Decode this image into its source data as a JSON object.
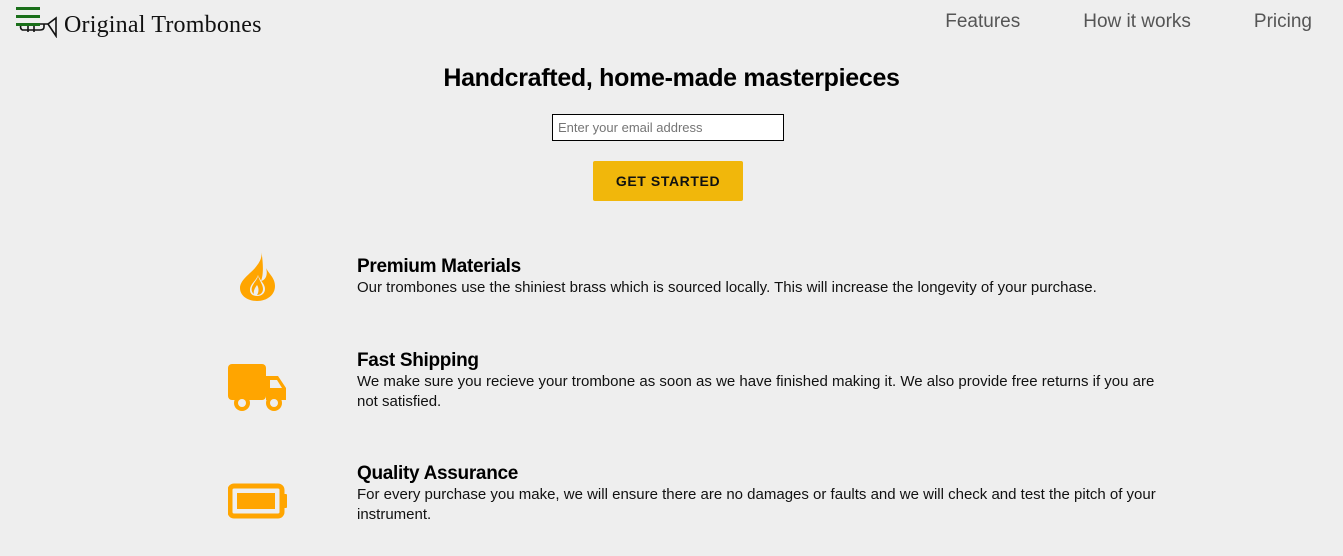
{
  "header": {
    "brand_title": "Original Trombones",
    "nav": [
      {
        "label": "Features"
      },
      {
        "label": "How it works"
      },
      {
        "label": "Pricing"
      }
    ],
    "menu_icon": "hamburger-menu-icon",
    "logo_icon": "trombone-logo-icon"
  },
  "hero": {
    "title": "Handcrafted, home-made masterpieces",
    "email_placeholder": "Enter your email address",
    "email_value": "",
    "cta_label": "GET STARTED"
  },
  "features": [
    {
      "icon": "fire-icon",
      "title": "Premium Materials",
      "description": "Our trombones use the shiniest brass which is sourced locally. This will increase the longevity of your purchase."
    },
    {
      "icon": "truck-icon",
      "title": "Fast Shipping",
      "description": "We make sure you recieve your trombone as soon as we have finished making it. We also provide free returns if you are not satisfied."
    },
    {
      "icon": "battery-full-icon",
      "title": "Quality Assurance",
      "description": "For every purchase you make, we will ensure there are no damages or faults and we will check and test the pitch of your instrument."
    }
  ],
  "colors": {
    "background": "#eeeeee",
    "accent": "#f1b70b",
    "icon": "#ffa500",
    "menu_icon": "#1a6f1a",
    "nav_text": "#555555"
  }
}
